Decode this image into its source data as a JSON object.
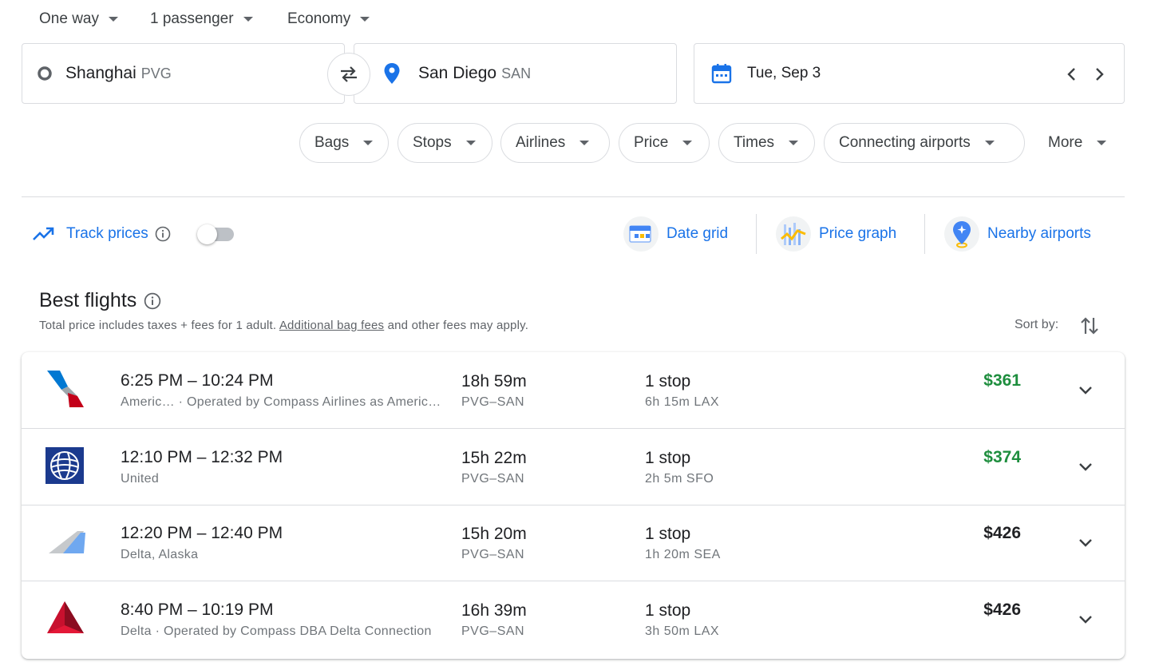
{
  "colors": {
    "accent": "#1a73e8",
    "price_good": "#1e8e3e",
    "price_normal": "#202124",
    "border": "#dadce0"
  },
  "search": {
    "trip_type": "One way",
    "passengers": "1 passenger",
    "cabin": "Economy",
    "origin": {
      "city": "Shanghai",
      "code": "PVG"
    },
    "destination": {
      "city": "San Diego",
      "code": "SAN"
    },
    "date": "Tue, Sep 3"
  },
  "filters": [
    "Bags",
    "Stops",
    "Airlines",
    "Price",
    "Times",
    "Connecting airports",
    "More"
  ],
  "tools": {
    "track_prices": "Track prices",
    "track_enabled": false,
    "date_grid": "Date grid",
    "price_graph": "Price graph",
    "nearby_airports": "Nearby airports"
  },
  "results": {
    "section_title": "Best flights",
    "note_prefix": "Total price includes taxes + fees for 1 adult. ",
    "note_link": "Additional bag fees",
    "note_suffix": " and other fees may apply.",
    "sort_label": "Sort by:",
    "flights": [
      {
        "logo": "american-airlines-logo",
        "times": "6:25 PM – 10:24 PM",
        "airline": "Americ… · Operated by Compass Airlines as America…",
        "duration": "18h 59m",
        "route": "PVG–SAN",
        "stops": "1 stop",
        "layover": "6h 15m LAX",
        "price": "$361",
        "price_status": "good"
      },
      {
        "logo": "united-logo",
        "times": "12:10 PM – 12:32 PM",
        "airline": "United",
        "duration": "15h 22m",
        "route": "PVG–SAN",
        "stops": "1 stop",
        "layover": "2h 5m SFO",
        "price": "$374",
        "price_status": "good"
      },
      {
        "logo": "multi-airline-logo",
        "times": "12:20 PM – 12:40 PM",
        "airline": "Delta, Alaska",
        "duration": "15h 20m",
        "route": "PVG–SAN",
        "stops": "1 stop",
        "layover": "1h 20m SEA",
        "price": "$426",
        "price_status": "normal"
      },
      {
        "logo": "delta-logo",
        "times": "8:40 PM – 10:19 PM",
        "airline": "Delta · Operated by Compass DBA Delta Connection",
        "duration": "16h 39m",
        "route": "PVG–SAN",
        "stops": "1 stop",
        "layover": "3h 50m LAX",
        "price": "$426",
        "price_status": "normal"
      }
    ]
  }
}
